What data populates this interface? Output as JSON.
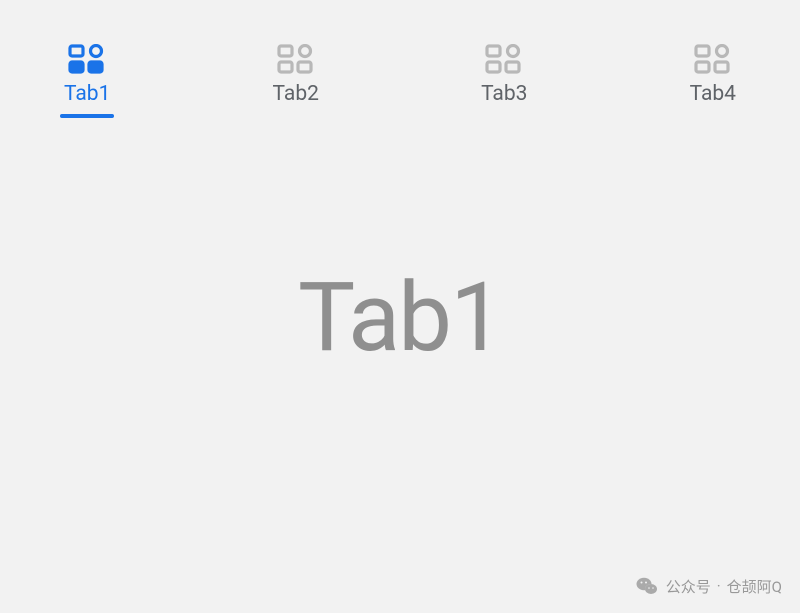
{
  "tabs": [
    {
      "label": "Tab1",
      "active": true
    },
    {
      "label": "Tab2",
      "active": false
    },
    {
      "label": "Tab3",
      "active": false
    },
    {
      "label": "Tab4",
      "active": false
    }
  ],
  "content": {
    "title": "Tab1"
  },
  "watermark": {
    "prefix": "公众号",
    "separator": "·",
    "name": "仓颉阿Q"
  },
  "colors": {
    "active": "#1a73e8",
    "inactive_icon": "#b8b8b8",
    "inactive_text": "#5f6368",
    "content_text": "#8f8f8f",
    "background": "#f2f2f2"
  }
}
